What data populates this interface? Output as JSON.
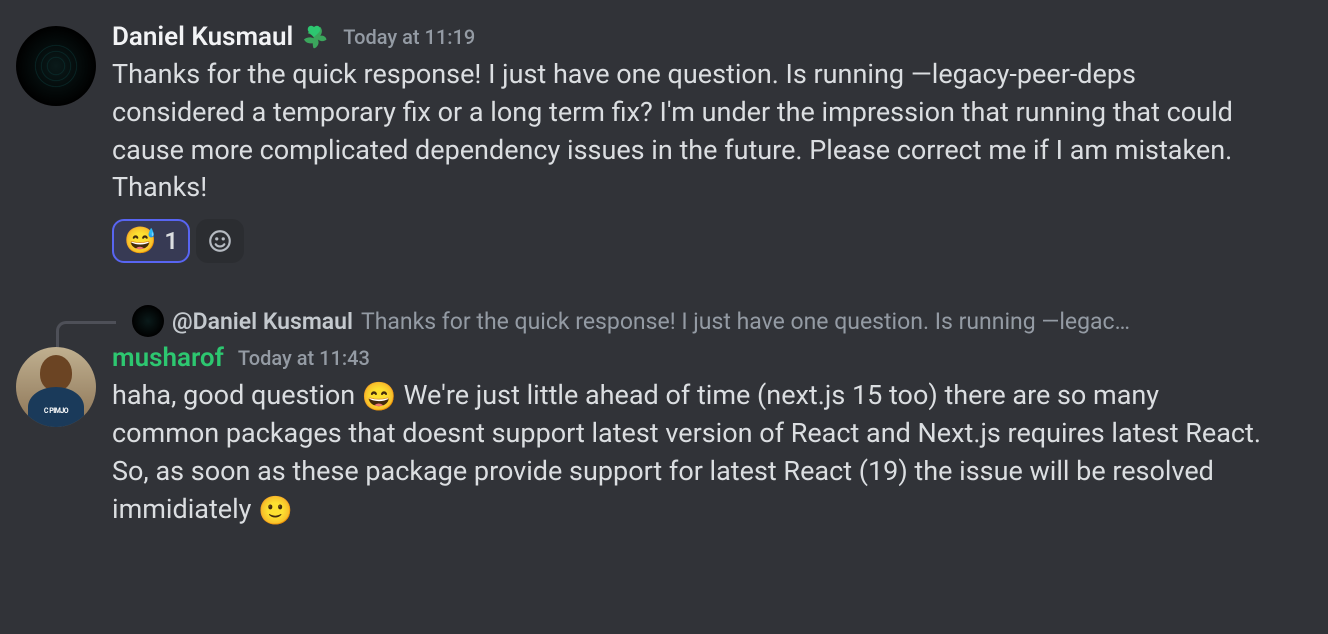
{
  "messages": [
    {
      "author": "Daniel Kusmaul",
      "timestamp": "Today at 11:19",
      "body": "Thanks for the quick response! I just have one question. Is running —legacy-peer-deps considered a temporary fix or a long term fix? I'm under the impression that running that could cause more complicated dependency issues in the future. Please correct me if I am mistaken. Thanks!",
      "reactions": [
        {
          "emoji": "😅",
          "count": "1"
        }
      ]
    },
    {
      "reply_to_author": "@Daniel Kusmaul",
      "reply_to_preview": "Thanks for the quick response! I just have one question. Is running —legac…",
      "author": "musharof",
      "timestamp": "Today at 11:43",
      "body_part1": "haha, good question ",
      "emoji1": "😄",
      "body_part2": " We're just little ahead of time (next.js 15 too) there are so many common packages that doesnt support latest version of React and Next.js requires latest React. So, as soon as these package provide support for latest React (19) the issue will be resolved immidiately ",
      "emoji2": "🙂"
    }
  ]
}
